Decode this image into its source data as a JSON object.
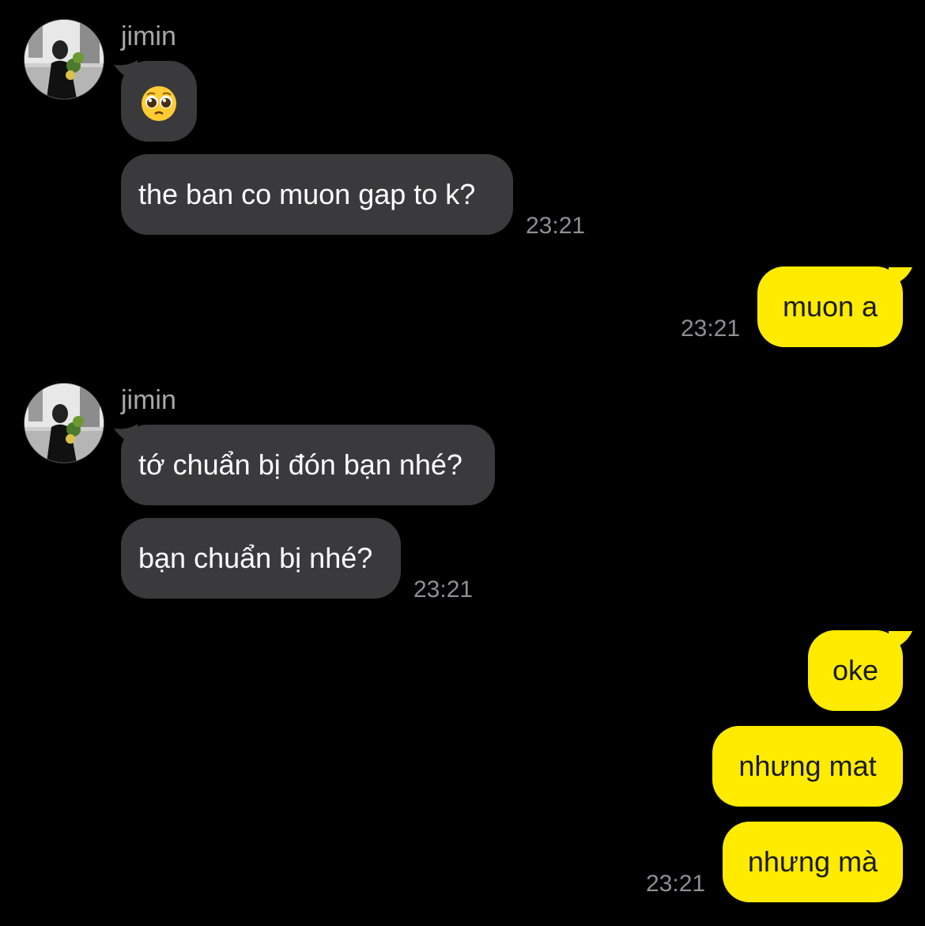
{
  "messages": [
    {
      "side": "in",
      "sender": "jimin",
      "text": "🥺"
    },
    {
      "side": "in",
      "text": "the ban co muon gap to k?",
      "time": "23:21"
    },
    {
      "side": "out",
      "text": "muon a",
      "time": "23:21"
    },
    {
      "side": "in",
      "sender": "jimin",
      "text": "tớ chuẩn bị đón bạn nhé?"
    },
    {
      "side": "in",
      "text": "bạn chuẩn bị nhé?",
      "time": "23:21"
    },
    {
      "side": "out",
      "text": "oke"
    },
    {
      "side": "out",
      "text": "nhưng mat"
    },
    {
      "side": "out",
      "text": "nhưng mà",
      "time": "23:21"
    }
  ],
  "emoji_names": {
    "pleading": "pleading-face-emoji"
  },
  "colors": {
    "background": "#000000",
    "incoming_bubble": "#3a3a3c",
    "outgoing_bubble": "#ffeb00",
    "timestamp": "#8e8e93",
    "sender_name": "#a8a8a8"
  }
}
